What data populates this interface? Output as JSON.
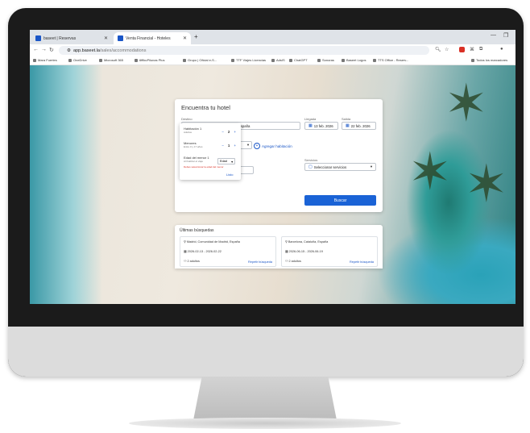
{
  "browser": {
    "tabs": [
      {
        "label": "baseet | Reservas",
        "active": false
      },
      {
        "label": "Venta Financial - Hoteles",
        "active": true
      }
    ],
    "url_host": "app.baseet.la",
    "url_path": "/sales/accommodations",
    "bookmarks": [
      "Mara Fuertes",
      "OneDrive",
      "Microsoft 365",
      "6ffikuPilunas Plus",
      "Grupo | Oficial e-S...",
      "TTF Viajes Licencias",
      "AdsIS",
      "ChatGPT",
      "Sonoras",
      "Baseet Logos",
      "TTS Office - Reserv...",
      "Todos los marcadores"
    ],
    "accent_color": "#1a56c7"
  },
  "form": {
    "title": "Encuentra tu hotel",
    "destino_label": "Destino",
    "destino_value": "Madrid, Comunidad de Madrid, España",
    "llegada_label": "Llegada",
    "llegada_value": "13 feb. 2026",
    "salida_label": "Salida",
    "salida_value": "22 feb. 2026",
    "habitacion_label": "Habitación 1",
    "habitacion_value": "2 adultos",
    "add_room_label": "Agregar habitación",
    "servicios_label": "Servicios",
    "servicios_placeholder": "Seleccionar servicios",
    "search_button": "Buscar"
  },
  "popup": {
    "title": "Habitación 1",
    "adultos_label": "Adultos",
    "adultos_value": "2",
    "ninos_label": "Menores",
    "ninos_sub": "Entre 0 y 17 años",
    "ninos_value": "1",
    "edad_label": "Edad del menor 1",
    "edad_sub": "Al finalizar el viaje",
    "edad_value": "Edad",
    "error_text": "Debes seleccionar la edad del menor",
    "done_label": "Listo"
  },
  "recent": {
    "title": "Últimas búsquedas",
    "items": [
      {
        "place": "Madrid, Comunidad de Madrid, España",
        "dates": "2026-02-13 - 2026-02-22",
        "guests": "2 adultos",
        "repeat": "Repetir búsqueda"
      },
      {
        "place": "Barcelona, Cataluña, España",
        "dates": "2026-06-15 - 2026-06-19",
        "guests": "2 adultos",
        "repeat": "Repetir búsqueda"
      }
    ]
  }
}
